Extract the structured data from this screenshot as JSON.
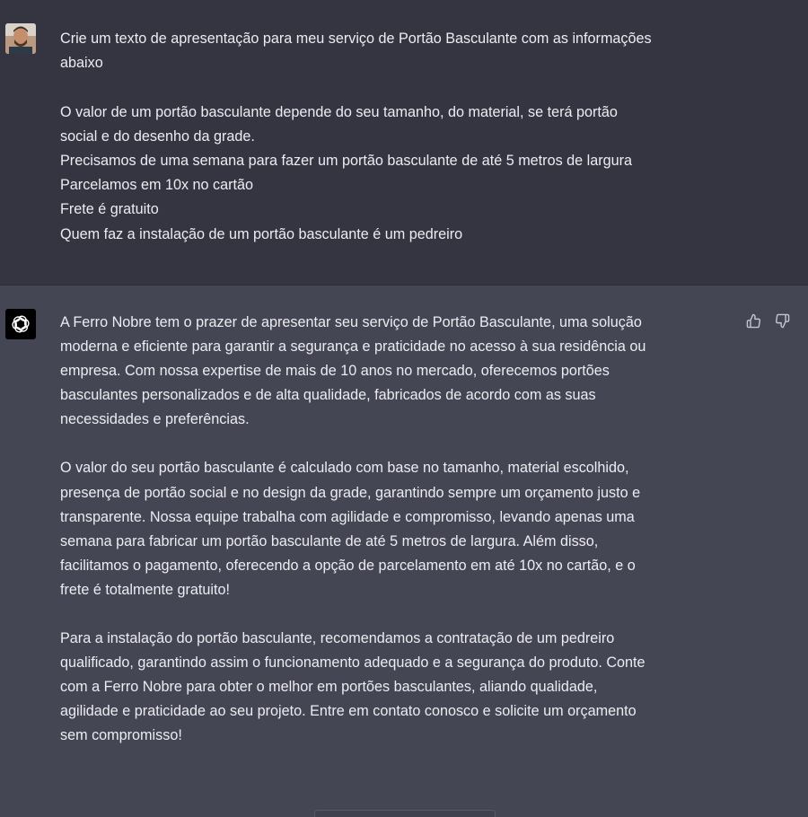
{
  "user_message": {
    "avatar": "user-avatar-photo",
    "lines": [
      "Crie um texto de apresentação para meu serviço de Portão Basculante com as informações",
      "abaixo",
      "",
      "O valor de um portão basculante depende do seu tamanho, do material, se terá portão",
      "social e do desenho da grade.",
      "Precisamos de uma semana para fazer um portão basculante de até 5 metros de largura",
      "Parcelamos em 10x no cartão",
      "Frete é gratuito",
      "Quem faz a instalação de um portão basculante é um pedreiro"
    ]
  },
  "assistant_message": {
    "avatar": "openai-logo-icon",
    "paragraphs": [
      {
        "lines": [
          "A Ferro Nobre tem o prazer de apresentar seu serviço de Portão Basculante, uma solução",
          "moderna e eficiente para garantir a segurança e praticidade no acesso à sua residência ou",
          "empresa. Com nossa expertise de mais de 10 anos no mercado, oferecemos portões",
          "basculantes personalizados e de alta qualidade, fabricados de acordo com as suas",
          "necessidades e preferências."
        ]
      },
      {
        "lines": [
          "O valor do seu portão basculante é calculado com base no tamanho, material escolhido,",
          "presença de portão social e no design da grade, garantindo sempre um orçamento justo e",
          "transparente. Nossa equipe trabalha com agilidade e compromisso, levando apenas uma",
          "semana para fabricar um portão basculante de até 5 metros de largura. Além disso,",
          "facilitamos o pagamento, oferecendo a opção de parcelamento em até 10x no cartão, e o",
          "frete é totalmente gratuito!"
        ]
      },
      {
        "lines": [
          "Para a instalação do portão basculante, recomendamos a contratação de um pedreiro",
          "qualificado, garantindo assim o funcionamento adequado e a segurança do produto. Conte",
          "com a Ferro Nobre para obter o melhor em portões basculantes, aliando qualidade,",
          "agilidade e praticidade ao seu projeto. Entre em contato conosco e solicite um orçamento",
          "sem compromisso!"
        ]
      }
    ],
    "feedback_icons": [
      "thumbs-up-icon",
      "thumbs-down-icon"
    ]
  },
  "colors": {
    "user_bg": "#343541",
    "assistant_bg": "#444654",
    "text": "#ececf1"
  }
}
